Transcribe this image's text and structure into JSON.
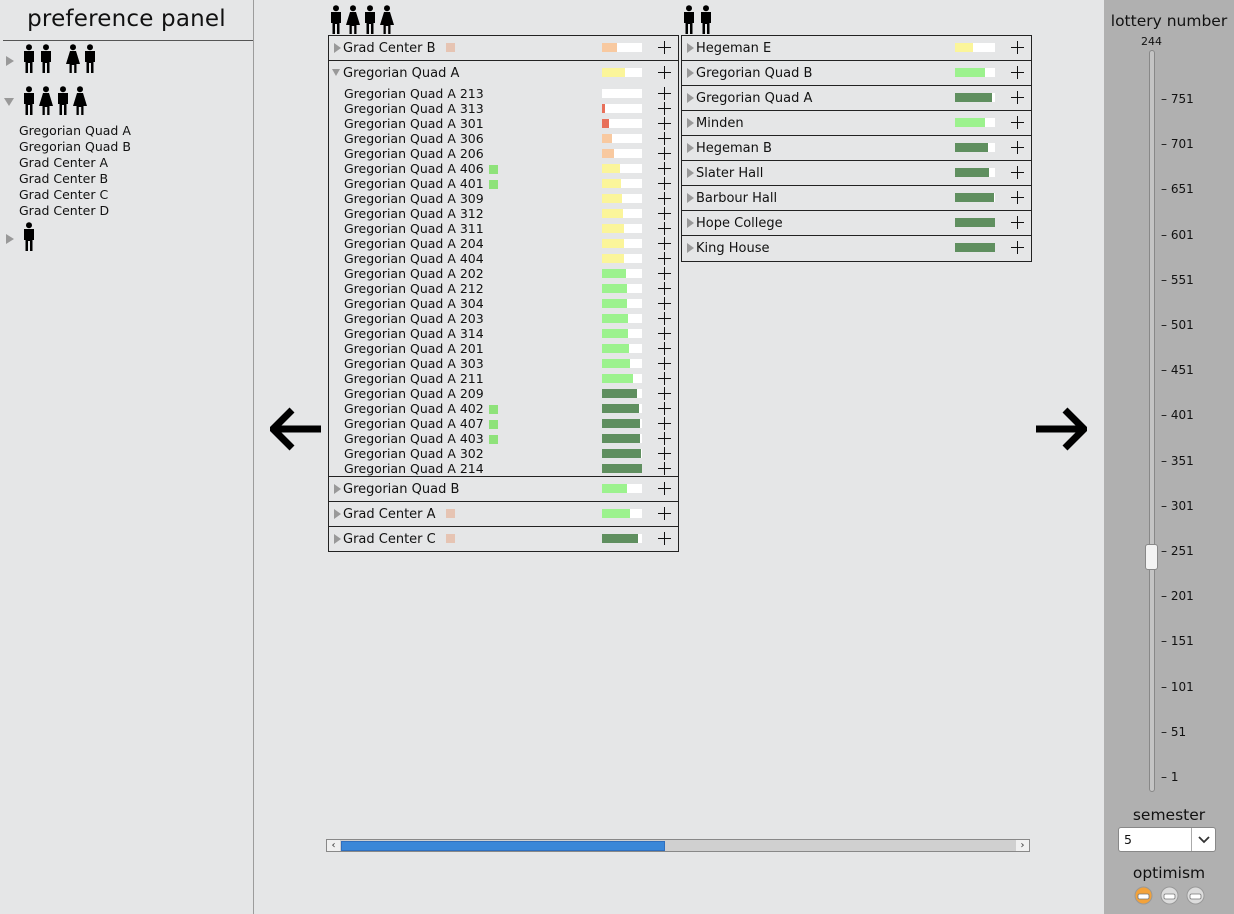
{
  "preference_panel": {
    "title": "preference panel",
    "groups": [
      {
        "expanded": false,
        "people": [
          "male",
          "male",
          "female",
          "male"
        ],
        "items": []
      },
      {
        "expanded": true,
        "people": [
          "male",
          "female",
          "male",
          "female"
        ],
        "items": [
          "Gregorian Quad A",
          "Gregorian Quad B",
          "Grad Center A",
          "Grad Center B",
          "Grad Center C",
          "Grad Center D"
        ]
      },
      {
        "expanded": false,
        "people": [
          "male"
        ],
        "items": []
      }
    ]
  },
  "left_list": {
    "header_people": [
      "male",
      "female",
      "male",
      "female"
    ],
    "rows": [
      {
        "label": "Grad Center B",
        "expanded": false,
        "marker": "#e6c4b3",
        "bar_color": "#f8c9a0",
        "bar_fraction": 0.38
      },
      {
        "label": "Gregorian Quad A",
        "expanded": true,
        "bar_color": "#fbf59a",
        "bar_fraction": 0.58,
        "children": [
          {
            "label": "Gregorian Quad A 213",
            "bar_color": "#ffffff",
            "bar_fraction": 0.0
          },
          {
            "label": "Gregorian Quad A 313",
            "bar_color": "#e8705a",
            "bar_fraction": 0.08
          },
          {
            "label": "Gregorian Quad A 301",
            "bar_color": "#e8705a",
            "bar_fraction": 0.18
          },
          {
            "label": "Gregorian Quad A 306",
            "bar_color": "#f8c9a0",
            "bar_fraction": 0.25
          },
          {
            "label": "Gregorian Quad A 206",
            "bar_color": "#f8c9a0",
            "bar_fraction": 0.3
          },
          {
            "label": "Gregorian Quad A 406",
            "marker": "#8ee27a",
            "bar_color": "#fbf59a",
            "bar_fraction": 0.45
          },
          {
            "label": "Gregorian Quad A 401",
            "marker": "#8ee27a",
            "bar_color": "#fbf59a",
            "bar_fraction": 0.48
          },
          {
            "label": "Gregorian Quad A 309",
            "bar_color": "#fbf59a",
            "bar_fraction": 0.5
          },
          {
            "label": "Gregorian Quad A 312",
            "bar_color": "#fbf59a",
            "bar_fraction": 0.53
          },
          {
            "label": "Gregorian Quad A 311",
            "bar_color": "#fbf59a",
            "bar_fraction": 0.55
          },
          {
            "label": "Gregorian Quad A 204",
            "bar_color": "#fbf59a",
            "bar_fraction": 0.55
          },
          {
            "label": "Gregorian Quad A 404",
            "bar_color": "#fbf59a",
            "bar_fraction": 0.55
          },
          {
            "label": "Gregorian Quad A 202",
            "bar_color": "#9cf28e",
            "bar_fraction": 0.6
          },
          {
            "label": "Gregorian Quad A 212",
            "bar_color": "#9cf28e",
            "bar_fraction": 0.63
          },
          {
            "label": "Gregorian Quad A 304",
            "bar_color": "#9cf28e",
            "bar_fraction": 0.63
          },
          {
            "label": "Gregorian Quad A 203",
            "bar_color": "#9cf28e",
            "bar_fraction": 0.65
          },
          {
            "label": "Gregorian Quad A 314",
            "bar_color": "#9cf28e",
            "bar_fraction": 0.65
          },
          {
            "label": "Gregorian Quad A 201",
            "bar_color": "#9cf28e",
            "bar_fraction": 0.68
          },
          {
            "label": "Gregorian Quad A 303",
            "bar_color": "#9cf28e",
            "bar_fraction": 0.7
          },
          {
            "label": "Gregorian Quad A 211",
            "bar_color": "#9cf28e",
            "bar_fraction": 0.78
          },
          {
            "label": "Gregorian Quad A 209",
            "bar_color": "#5f8f5f",
            "bar_fraction": 0.88
          },
          {
            "label": "Gregorian Quad A 402",
            "marker": "#8ee27a",
            "bar_color": "#5f8f5f",
            "bar_fraction": 0.93
          },
          {
            "label": "Gregorian Quad A 407",
            "marker": "#8ee27a",
            "bar_color": "#5f8f5f",
            "bar_fraction": 0.95
          },
          {
            "label": "Gregorian Quad A 403",
            "marker": "#8ee27a",
            "bar_color": "#5f8f5f",
            "bar_fraction": 0.96
          },
          {
            "label": "Gregorian Quad A 302",
            "bar_color": "#5f8f5f",
            "bar_fraction": 0.98
          },
          {
            "label": "Gregorian Quad A 214",
            "bar_color": "#5f8f5f",
            "bar_fraction": 1.0
          }
        ]
      },
      {
        "label": "Gregorian Quad B",
        "expanded": false,
        "bar_color": "#9cf28e",
        "bar_fraction": 0.63
      },
      {
        "label": "Grad Center A",
        "expanded": false,
        "marker": "#e6c4b3",
        "bar_color": "#9cf28e",
        "bar_fraction": 0.7
      },
      {
        "label": "Grad Center C",
        "expanded": false,
        "marker": "#e6c4b3",
        "bar_color": "#5f8f5f",
        "bar_fraction": 0.9
      }
    ]
  },
  "right_list": {
    "header_people": [
      "male",
      "male"
    ],
    "rows": [
      {
        "label": "Hegeman E",
        "bar_color": "#fbf59a",
        "bar_fraction": 0.45
      },
      {
        "label": "Gregorian Quad B",
        "bar_color": "#9cf28e",
        "bar_fraction": 0.75
      },
      {
        "label": "Gregorian Quad A",
        "bar_color": "#5f8f5f",
        "bar_fraction": 0.92
      },
      {
        "label": "Minden",
        "bar_color": "#9cf28e",
        "bar_fraction": 0.75
      },
      {
        "label": "Hegeman B",
        "bar_color": "#5f8f5f",
        "bar_fraction": 0.82
      },
      {
        "label": "Slater Hall",
        "bar_color": "#5f8f5f",
        "bar_fraction": 0.85
      },
      {
        "label": "Barbour Hall",
        "bar_color": "#5f8f5f",
        "bar_fraction": 0.97
      },
      {
        "label": "Hope College",
        "bar_color": "#5f8f5f",
        "bar_fraction": 0.99
      },
      {
        "label": "King House",
        "bar_color": "#5f8f5f",
        "bar_fraction": 1.0
      }
    ]
  },
  "navigation": {
    "left_icon": "arrow-left-icon",
    "right_icon": "arrow-right-icon"
  },
  "horizontal_scroll": {
    "fraction_visible": 0.48
  },
  "lottery": {
    "title": "lottery number",
    "value": "244",
    "value_fraction": 0.32,
    "ticks": [
      "751",
      "701",
      "651",
      "601",
      "551",
      "501",
      "451",
      "401",
      "351",
      "301",
      "251",
      "201",
      "151",
      "101",
      "51",
      "1"
    ]
  },
  "semester": {
    "title": "semester",
    "value": "5"
  },
  "optimism": {
    "title": "optimism",
    "faces": [
      "happy-face-icon",
      "neutral-face-icon",
      "sad-face-icon"
    ],
    "selected": 0
  }
}
